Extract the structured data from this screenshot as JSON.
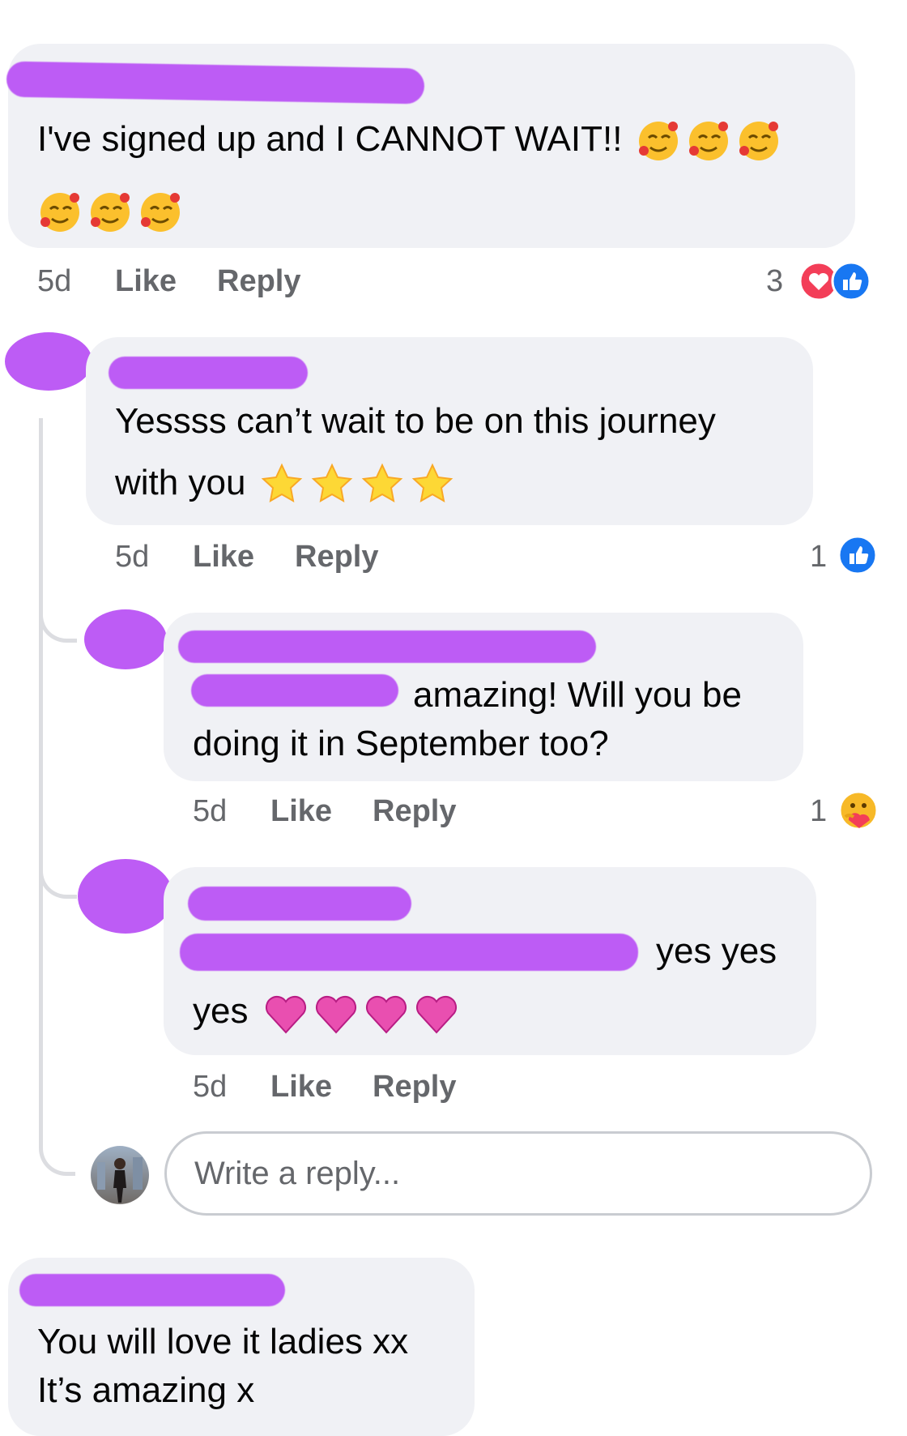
{
  "comments": [
    {
      "text_lines": [
        "I've signed up and I CANNOT WAIT!!",
        ""
      ],
      "emoji_row1": "smiling-face-with-hearts",
      "emoji_row2": "smiling-face-with-hearts",
      "time": "5d",
      "like_label": "Like",
      "reply_label": "Reply",
      "reaction_count": "3",
      "reactions": [
        "heart-reaction-icon",
        "like-reaction-icon"
      ]
    },
    {
      "text_lines": [
        "Yessss can’t wait to be on this journey",
        "with you"
      ],
      "emoji": "glowing-star",
      "time": "5d",
      "like_label": "Like",
      "reply_label": "Reply",
      "reaction_count": "1",
      "reactions": [
        "like-reaction-icon"
      ]
    },
    {
      "text_lines": [
        "amazing! Will you be",
        "doing it in September too?"
      ],
      "time": "5d",
      "like_label": "Like",
      "reply_label": "Reply",
      "reaction_count": "1",
      "reactions": [
        "care-reaction-icon"
      ]
    },
    {
      "text_lines": [
        "yes yes",
        "yes"
      ],
      "emoji": "sparkling-heart",
      "time": "5d",
      "like_label": "Like",
      "reply_label": "Reply"
    },
    {
      "text_lines": [
        "You will love it ladies xx",
        "It’s amazing x"
      ]
    }
  ],
  "reply_box": {
    "placeholder": "Write a reply..."
  },
  "colors": {
    "bubble": "#f0f1f5",
    "redaction": "#bd5cf5",
    "meta_text": "#65676b",
    "like_blue": "#1877f2",
    "love_red": "#f33e58"
  }
}
